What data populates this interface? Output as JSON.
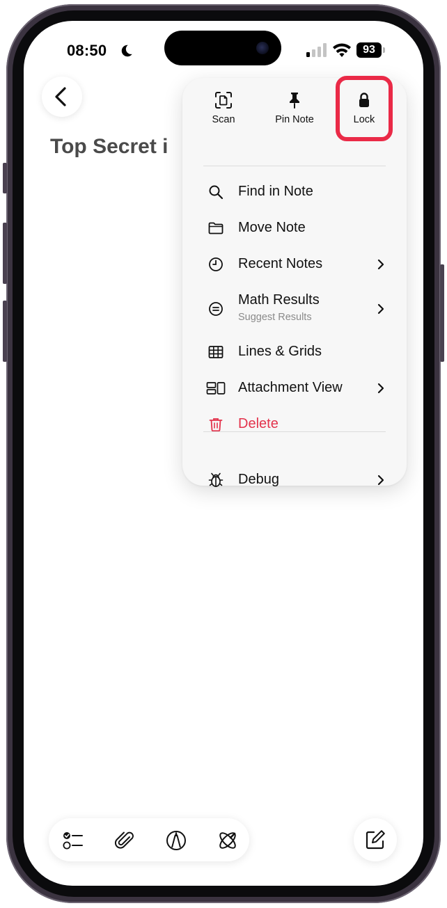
{
  "status_bar": {
    "time": "08:50",
    "battery": "93",
    "icons": [
      "moon-icon",
      "signal-icon",
      "wifi-icon",
      "battery-icon"
    ]
  },
  "note": {
    "title": "Top Secret i"
  },
  "menu": {
    "top_actions": [
      {
        "label": "Scan",
        "icon": "scan-document-icon"
      },
      {
        "label": "Pin Note",
        "icon": "pin-icon"
      },
      {
        "label": "Lock",
        "icon": "lock-icon"
      }
    ],
    "items": [
      {
        "label": "Find in Note",
        "icon": "magnifier-icon"
      },
      {
        "label": "Move Note",
        "icon": "folder-icon"
      },
      {
        "label": "Recent Notes",
        "icon": "clock-icon",
        "submenu": true
      },
      {
        "label": "Math Results",
        "sublabel": "Suggest Results",
        "icon": "equals-circle-icon",
        "submenu": true
      },
      {
        "label": "Lines & Grids",
        "icon": "grid-icon"
      },
      {
        "label": "Attachment View",
        "icon": "attachment-view-icon",
        "submenu": true
      },
      {
        "label": "Delete",
        "icon": "trash-icon",
        "destructive": true
      },
      {
        "label": "Debug",
        "icon": "ladybug-icon",
        "submenu": true
      }
    ]
  },
  "toolbar": {
    "icons": [
      "checklist-icon",
      "paperclip-icon",
      "markup-pen-icon",
      "writing-tools-icon",
      "compose-icon"
    ]
  },
  "colors": {
    "destructive": "#e3334c",
    "highlight": "#ea2a47",
    "frame": "#3b3340"
  }
}
